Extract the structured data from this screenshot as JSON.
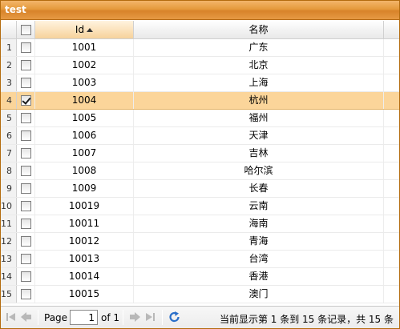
{
  "panel": {
    "title": "test"
  },
  "header": {
    "id_label": "Id",
    "name_label": "名称",
    "sort_column": "Id",
    "sort_direction": "asc"
  },
  "rows": [
    {
      "num": "1",
      "id": "1001",
      "name": "广东",
      "checked": false,
      "selected": false
    },
    {
      "num": "2",
      "id": "1002",
      "name": "北京",
      "checked": false,
      "selected": false
    },
    {
      "num": "3",
      "id": "1003",
      "name": "上海",
      "checked": false,
      "selected": false
    },
    {
      "num": "4",
      "id": "1004",
      "name": "杭州",
      "checked": true,
      "selected": true
    },
    {
      "num": "5",
      "id": "1005",
      "name": "福州",
      "checked": false,
      "selected": false
    },
    {
      "num": "6",
      "id": "1006",
      "name": "天津",
      "checked": false,
      "selected": false
    },
    {
      "num": "7",
      "id": "1007",
      "name": "吉林",
      "checked": false,
      "selected": false
    },
    {
      "num": "8",
      "id": "1008",
      "name": "哈尔滨",
      "checked": false,
      "selected": false
    },
    {
      "num": "9",
      "id": "1009",
      "name": "长春",
      "checked": false,
      "selected": false
    },
    {
      "num": "10",
      "id": "10019",
      "name": "云南",
      "checked": false,
      "selected": false
    },
    {
      "num": "11",
      "id": "10011",
      "name": "海南",
      "checked": false,
      "selected": false
    },
    {
      "num": "12",
      "id": "10012",
      "name": "青海",
      "checked": false,
      "selected": false
    },
    {
      "num": "13",
      "id": "10013",
      "name": "台湾",
      "checked": false,
      "selected": false
    },
    {
      "num": "14",
      "id": "10014",
      "name": "香港",
      "checked": false,
      "selected": false
    },
    {
      "num": "15",
      "id": "10015",
      "name": "澳门",
      "checked": false,
      "selected": false
    }
  ],
  "pager": {
    "page_label": "Page",
    "page_value": "1",
    "of_label": "of 1",
    "info": "当前显示第 1 条到 15 条记录，共 15 条",
    "icons": [
      "first-page-icon",
      "prev-page-icon",
      "next-page-icon",
      "last-page-icon",
      "refresh-icon"
    ]
  },
  "colors": {
    "title_bar": "#e59a3c",
    "selected_row": "#fbd59a",
    "sorted_header": "#fbe3bd",
    "refresh": "#2a6fc9"
  }
}
